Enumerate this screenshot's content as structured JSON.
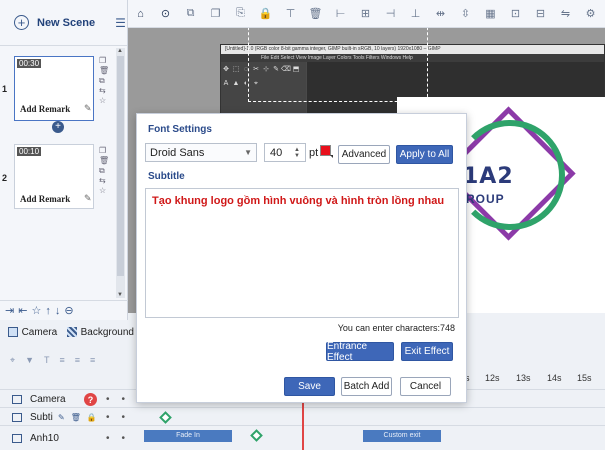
{
  "scene_panel": {
    "new_scene_label": "New Scene",
    "scenes": [
      {
        "number": "1",
        "duration": "00:30",
        "remark": "Add Remark",
        "selected": true
      },
      {
        "number": "2",
        "duration": "00:10",
        "remark": "Add Remark",
        "selected": false
      }
    ]
  },
  "dialog": {
    "font_settings_title": "Font Settings",
    "font_family": "Droid Sans",
    "font_size": "40",
    "font_unit": "pt",
    "font_color": "#e8101c",
    "advanced_label": "Advanced",
    "apply_all_label": "Apply to All",
    "subtitle_title": "Subtitle",
    "subtitle_text": "Tạo khung logo gồm hình vuông và hình tròn lồng nhau",
    "char_info": "You can enter characters:748",
    "entrance_label": "Entrance Effect",
    "exit_label": "Exit Effect",
    "save_label": "Save",
    "batch_add_label": "Batch Add",
    "cancel_label": "Cancel"
  },
  "canvas": {
    "gimp_title": "[Untitled]-1.0 (RGB color 8-bit gamma integer, GIMP built-in sRGB, 10 layers) 1920x1080 – GIMP",
    "gimp_menu": "File  Edit  Select  View  Image  Layer  Colors  Tools  Filters  Windows  Help",
    "logo_text": "1A2",
    "logo_subtext": "T GROUP",
    "player_partial": "ence"
  },
  "object_bar": {
    "camera_label": "Camera",
    "background_label": "Background"
  },
  "timeline": {
    "ruler": [
      "s",
      "12s",
      "13s",
      "14s",
      "15s"
    ],
    "tracks": [
      {
        "name": "Camera"
      },
      {
        "name": "Subti"
      },
      {
        "name": "Anh10"
      }
    ],
    "fade_in_label": "Fade In",
    "custom_exit_label": "Custom exit"
  },
  "colors": {
    "accent": "#3e67b8",
    "subtitle_text": "#d01818",
    "logo_purple": "#8c3aa8",
    "logo_green": "#2fa36a"
  }
}
